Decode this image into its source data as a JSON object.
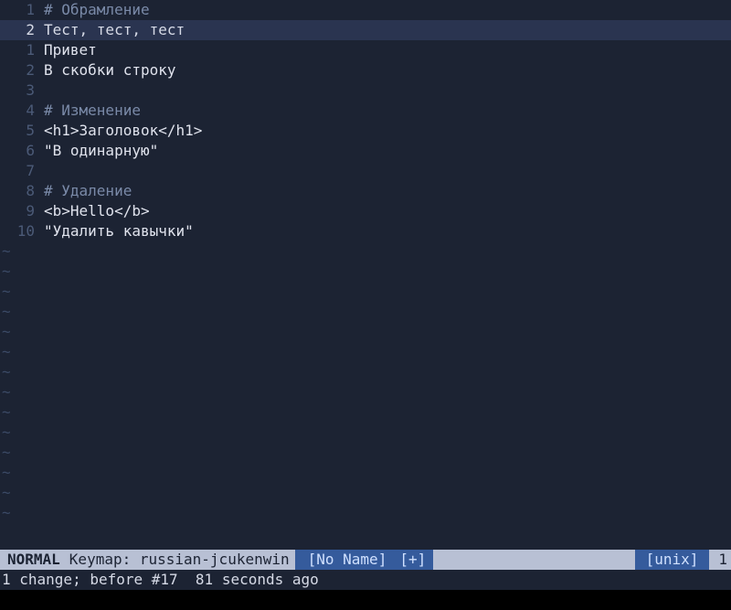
{
  "lines": [
    {
      "num": "1",
      "current": false,
      "text": "# Обрамление",
      "cls": "comment"
    },
    {
      "num": "2",
      "current": true,
      "text": "Тест, тест, тест",
      "cls": ""
    },
    {
      "num": "1",
      "current": false,
      "text": "Привет",
      "cls": ""
    },
    {
      "num": "2",
      "current": false,
      "text": "В скобки строку",
      "cls": ""
    },
    {
      "num": "3",
      "current": false,
      "text": "",
      "cls": ""
    },
    {
      "num": "4",
      "current": false,
      "text": "# Изменение",
      "cls": "comment"
    },
    {
      "num": "5",
      "current": false,
      "text": "<h1>Заголовок</h1>",
      "cls": ""
    },
    {
      "num": "6",
      "current": false,
      "text": "\"В одинарную\"",
      "cls": ""
    },
    {
      "num": "7",
      "current": false,
      "text": "",
      "cls": ""
    },
    {
      "num": "8",
      "current": false,
      "text": "# Удаление",
      "cls": "comment"
    },
    {
      "num": "9",
      "current": false,
      "text": "<b>Hello</b>",
      "cls": ""
    },
    {
      "num": "10",
      "current": false,
      "text": "\"Удалить кавычки\"",
      "cls": ""
    }
  ],
  "tilde_count": 14,
  "tilde_char": "~",
  "status": {
    "mode": "NORMAL",
    "keymap": "Keymap: russian-jcukenwin",
    "file": "[No Name]",
    "modified": "[+]",
    "format": "[unix]",
    "right": "1"
  },
  "cmdline": "1 change; before #17  81 seconds ago"
}
